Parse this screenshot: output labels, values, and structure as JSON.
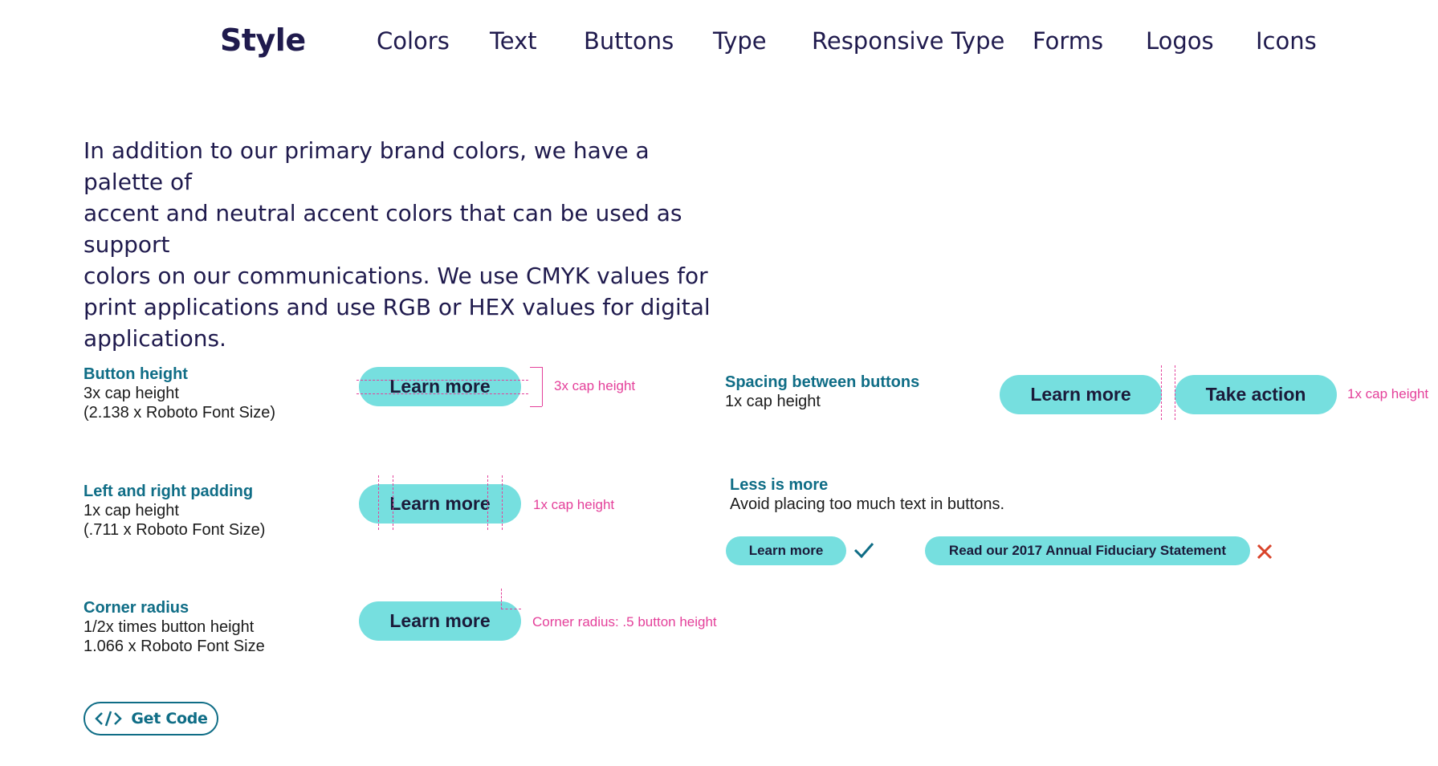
{
  "header": {
    "brand": "Style",
    "nav": [
      "Colors",
      "Text",
      "Buttons",
      "Type",
      "Responsive Type",
      "Forms",
      "Logos",
      "Icons"
    ]
  },
  "intro": {
    "lines": [
      "In addition to our primary brand colors, we have a palette of",
      "accent and neutral accent colors that can be used as support",
      "colors on our communications. We use CMYK values for",
      "print applications and use RGB or HEX values for digital",
      "applications."
    ]
  },
  "button_height": {
    "title": "Button height",
    "line1": "3x cap height",
    "line2": "(2.138 x Roboto Font Size)",
    "button": "Learn more",
    "note": "3x cap height"
  },
  "padding": {
    "title": "Left and right padding",
    "line1": "1x cap height",
    "line2": "(.711 x Roboto Font Size)",
    "button": "Learn more",
    "note": "1x cap height"
  },
  "corner": {
    "title": "Corner radius",
    "line1": "1/2x times button height",
    "line2": "1.066 x Roboto Font Size",
    "button": "Learn more",
    "note": "Corner radius: .5 button height"
  },
  "spacing": {
    "title": "Spacing between buttons",
    "line1": "1x cap height",
    "button1": "Learn more",
    "button2": "Take action",
    "note": "1x cap height"
  },
  "less_is_more": {
    "title": "Less is more",
    "line1": "Avoid placing too much text in buttons.",
    "good_button": "Learn more",
    "bad_button": "Read our 2017 Annual Fiduciary Statement",
    "good_icon": "check-icon",
    "bad_icon": "x-icon"
  },
  "get_code": {
    "label": "Get Code",
    "icon": "code-icon"
  },
  "colors": {
    "accent_button": "#76dfdf",
    "heading_teal": "#0f6d86",
    "annotation_pink": "#e4409a",
    "navy": "#1f1a4d",
    "bad_red": "#d9432a"
  }
}
